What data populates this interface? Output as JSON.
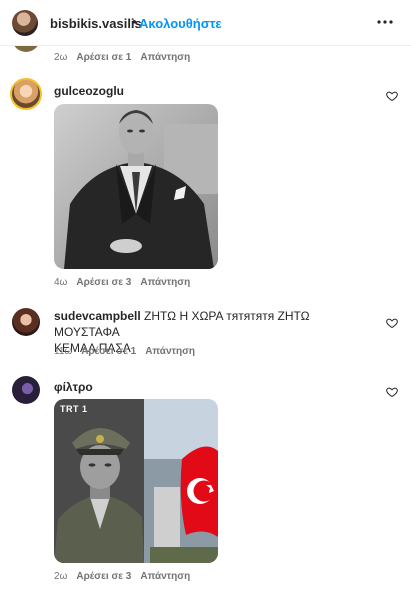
{
  "header": {
    "username": "bisbikis.vasilis",
    "separator": "•",
    "follow_label": "Ακολουθήστε",
    "more_icon": "more-horizontal-icon"
  },
  "comments": [
    {
      "username": "",
      "text": "",
      "time": "2ω",
      "likes": "Αρέσει σε 1",
      "reply": "Απάντηση"
    },
    {
      "username": "gulceozoglu",
      "text": "",
      "time": "4ω",
      "likes": "Αρέσει σε 3",
      "reply": "Απάντηση",
      "media": "portrait-photo-black-and-white"
    },
    {
      "username": "sudevcampbell",
      "text_line1": "ΖΗΤΩ Η ΧΩΡΑ тятятятя ΖΗΤΩ ΜΟΥΣΤΑΦΑ",
      "text_line2": "ΚΕΜΑΛ ΠΑΣΑ",
      "time": "11ω",
      "likes": "Αρέσει σε 1",
      "reply": "Απάντηση"
    },
    {
      "username": "φίλτρο",
      "text": "",
      "time": "2ω",
      "likes": "Αρέσει σε 3",
      "reply": "Απάντηση",
      "media": "portrait-with-flag-video",
      "media_badge": "TRT 1"
    }
  ],
  "colors": {
    "link": "#0095f6",
    "meta": "#737373",
    "text": "#262626",
    "flag_red": "#e30a17"
  }
}
